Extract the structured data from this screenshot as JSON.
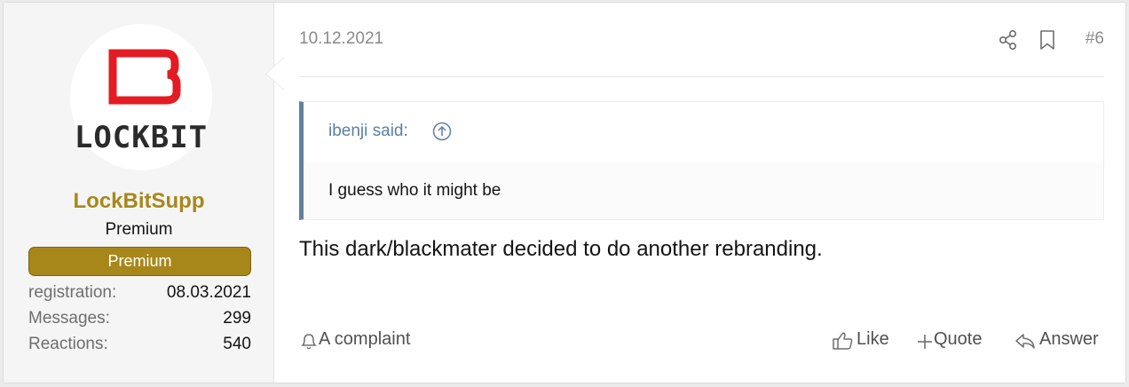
{
  "user": {
    "avatar_logo_text": "LOCKBIT",
    "username": "LockBitSupp",
    "title": "Premium",
    "banner": "Premium",
    "stats": [
      {
        "label": "registration:",
        "value": "08.03.2021"
      },
      {
        "label": "Messages:",
        "value": "299"
      },
      {
        "label": "Reactions:",
        "value": "540"
      }
    ]
  },
  "post": {
    "date": "10.12.2021",
    "number": "#6",
    "quote": {
      "author": "ibenji said:",
      "text": "I guess who it might be"
    },
    "message": "This dark/blackmater decided to do another rebranding.",
    "footer": {
      "report": "A complaint",
      "like": "Like",
      "quote": "Quote",
      "reply": "Answer"
    }
  },
  "icons": {
    "share": "share-icon",
    "bookmark": "bookmark-icon",
    "jump": "arrow-up-circle-icon",
    "report": "bell-icon",
    "like": "thumbs-up-icon",
    "quote": "plus-icon",
    "reply": "reply-icon"
  },
  "colors": {
    "accent_gold": "#a8871a",
    "quote_border": "#647f9e",
    "quote_author": "#5d7fa6",
    "logo_red": "#e31b23"
  }
}
